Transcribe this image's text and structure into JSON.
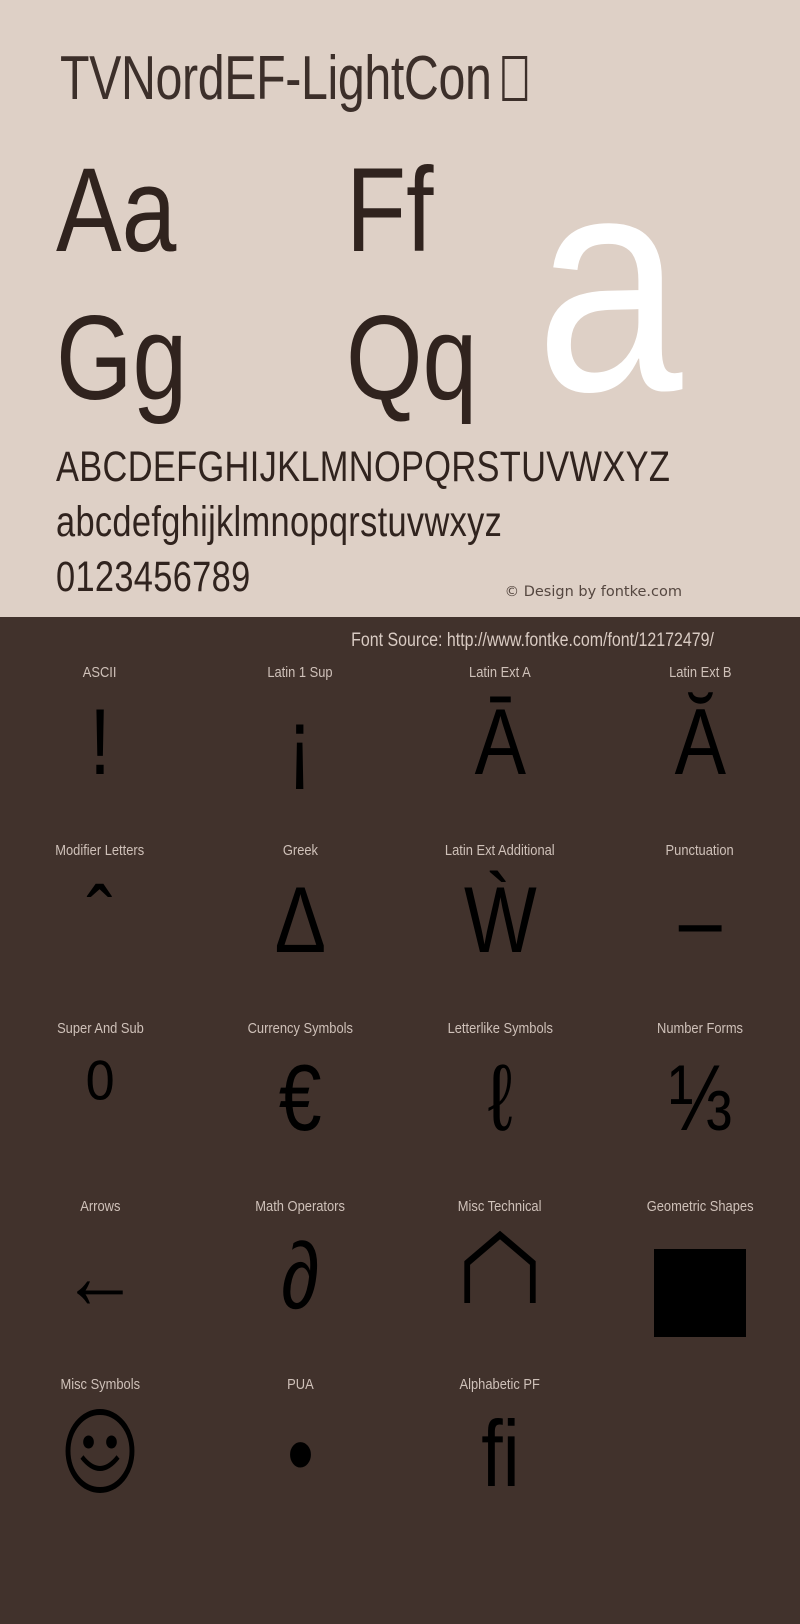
{
  "specimen": {
    "title": "TVNordEF-LightCon",
    "title_trailing_glyph": "missing-glyph-box",
    "letter_pairs": [
      "Aa",
      "Ff",
      "Gg",
      "Qq"
    ],
    "showcase_letter": "a",
    "uppercase_alphabet": "ABCDEFGHIJKLMNOPQRSTUVWXYZ",
    "lowercase_alphabet": "abcdefghijklmnopqrstuvwxyz",
    "digits": "0123456789",
    "copyright": "© Design by fontke.com",
    "font_source": "Font Source: http://www.fontke.com/font/12172479/"
  },
  "colors": {
    "top_background": "#ded0c6",
    "bottom_background": "#41322c",
    "ink": "#30231e",
    "showcase": "#ffffff",
    "label": "#cfc1b9"
  },
  "unicode_blocks": [
    [
      {
        "label": "ASCII",
        "glyph": "!",
        "glyph_name": "exclamation-mark"
      },
      {
        "label": "Latin 1 Sup",
        "glyph": "¡",
        "glyph_name": "inverted-exclamation-mark"
      },
      {
        "label": "Latin Ext A",
        "glyph": "Ā",
        "glyph_name": "a-macron"
      },
      {
        "label": "Latin Ext B",
        "glyph": "Ă",
        "glyph_name": "a-breve"
      }
    ],
    [
      {
        "label": "Modifier Letters",
        "glyph": "ˆ",
        "glyph_name": "modifier-circumflex"
      },
      {
        "label": "Greek",
        "glyph": "Δ",
        "glyph_name": "greek-capital-delta"
      },
      {
        "label": "Latin Ext Additional",
        "glyph": "Ẁ",
        "glyph_name": "w-grave"
      },
      {
        "label": "Punctuation",
        "glyph": "–",
        "glyph_name": "en-dash"
      }
    ],
    [
      {
        "label": "Super And Sub",
        "glyph": "⁰",
        "glyph_name": "superscript-zero"
      },
      {
        "label": "Currency Symbols",
        "glyph": "€",
        "glyph_name": "euro-sign"
      },
      {
        "label": "Letterlike Symbols",
        "glyph": "ℓ",
        "glyph_name": "script-small-l"
      },
      {
        "label": "Number Forms",
        "glyph": "⅓",
        "glyph_name": "one-third-fraction"
      }
    ],
    [
      {
        "label": "Arrows",
        "glyph": "←",
        "glyph_name": "leftwards-arrow"
      },
      {
        "label": "Math Operators",
        "glyph": "∂",
        "glyph_name": "partial-differential"
      },
      {
        "label": "Misc Technical",
        "glyph": "⌂",
        "glyph_name": "house-symbol"
      },
      {
        "label": "Geometric Shapes",
        "glyph": "■",
        "glyph_name": "black-square"
      }
    ],
    [
      {
        "label": "Misc Symbols",
        "glyph": "☺",
        "glyph_name": "white-smiling-face"
      },
      {
        "label": "PUA",
        "glyph": "•",
        "glyph_name": "bullet-dot"
      },
      {
        "label": "Alphabetic PF",
        "glyph": "ﬁ",
        "glyph_name": "fi-ligature"
      },
      {
        "label": "",
        "glyph": "",
        "glyph_name": "empty"
      }
    ]
  ]
}
